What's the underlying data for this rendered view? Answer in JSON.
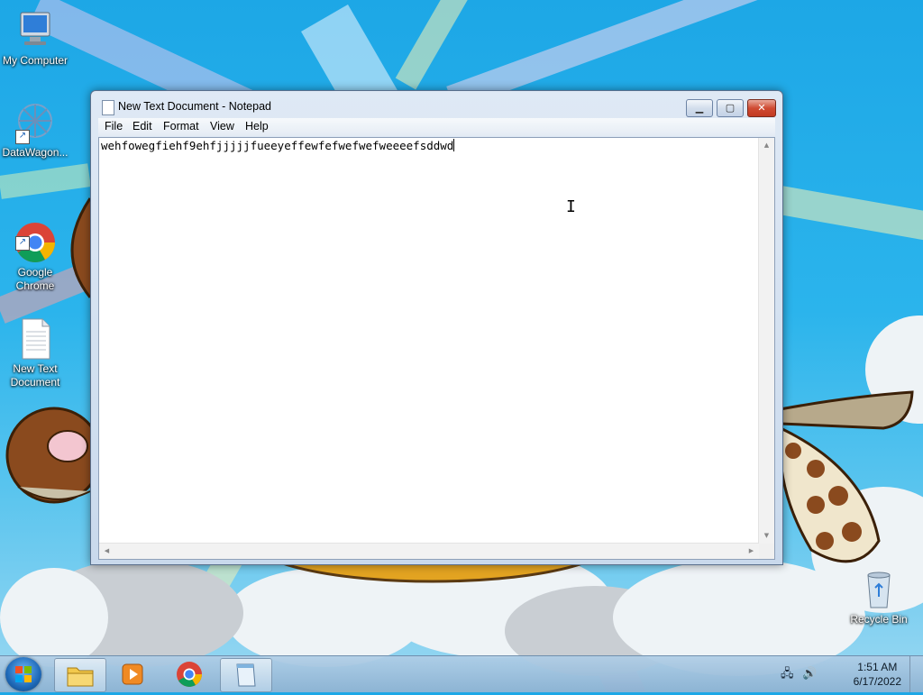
{
  "desktop": {
    "icons": [
      {
        "label": "My Computer"
      },
      {
        "label": "DataWagon..."
      },
      {
        "label": "Google\nChrome"
      },
      {
        "label": "New Text\nDocument"
      },
      {
        "label": "Recycle Bin"
      }
    ]
  },
  "window": {
    "title": "New Text Document - Notepad",
    "controls": {
      "minimize": "▁",
      "maximize": "▢",
      "close": "✕"
    },
    "menu": [
      "File",
      "Edit",
      "Format",
      "View",
      "Help"
    ],
    "content": "wehfowegfiehf9ehfjjjjjfueeyeffewfefwefwefweeeefsddwd"
  },
  "taskbar": {
    "pinned": [
      "windows-explorer",
      "media-player",
      "google-chrome",
      "notepad"
    ],
    "clock_time": "1:51 AM",
    "clock_date": "6/17/2022"
  },
  "colors": {
    "sky": "#1da7e6",
    "window_frame": "#c9d9ec",
    "close_button": "#c23a22",
    "taskbar": "#8cb2d2"
  }
}
